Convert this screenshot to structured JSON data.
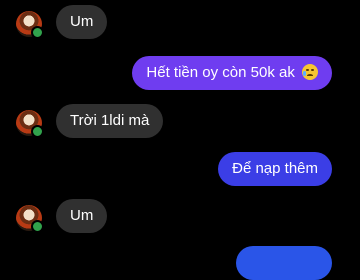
{
  "conversation": {
    "messages": [
      {
        "sender": "them",
        "text": "Um",
        "has_avatar": true
      },
      {
        "sender": "me",
        "text": "Hết tiền oy còn 50k ak",
        "emoji": "crying-face-emoji",
        "bubble_color": "#6f3df0"
      },
      {
        "sender": "them",
        "text": "Trời 1ldi mà",
        "has_avatar": true
      },
      {
        "sender": "me",
        "text": "Để nạp thêm",
        "bubble_color": "#3b3ee6"
      },
      {
        "sender": "them",
        "text": "Um",
        "has_avatar": true
      },
      {
        "sender": "me",
        "text": "",
        "bubble_color": "#2a55e8",
        "partially_visible": true
      }
    ],
    "colors": {
      "incoming_bubble": "#303030",
      "online_indicator": "#31a24c",
      "background": "#000000"
    }
  }
}
